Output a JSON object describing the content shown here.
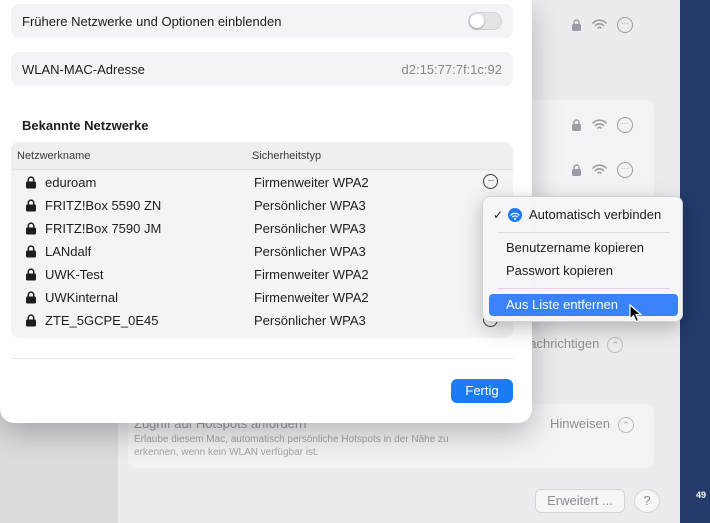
{
  "background": {
    "notifications_label": "nachrichtigen",
    "hotspot_title": "Zugriff auf Hotspots anfordern",
    "hotspot_desc_1": "Erlaube diesem Mac, automatisch persönliche Hotspots in der Nähe zu",
    "hotspot_desc_2": "erkennen, wenn kein WLAN verfügbar ist.",
    "hotspot_value": "Hinweisen",
    "advanced_button": "Erweitert ...",
    "help_button": "?",
    "dock_number": "49"
  },
  "sheet": {
    "show_legacy_label": "Frühere Netzwerke und Optionen einblenden",
    "mac_label": "WLAN-MAC-Adresse",
    "mac_value": "d2:15:77:7f:1c:92",
    "known_title": "Bekannte Netzwerke",
    "col_name": "Netzwerkname",
    "col_security": "Sicherheitstyp",
    "networks": [
      {
        "name": "eduroam",
        "security": "Firmenweiter WPA2"
      },
      {
        "name": "FRITZ!Box 5590 ZN",
        "security": "Persönlicher WPA3"
      },
      {
        "name": "FRITZ!Box 7590 JM",
        "security": "Persönlicher WPA3"
      },
      {
        "name": "LANdalf",
        "security": "Persönlicher WPA3"
      },
      {
        "name": "UWK-Test",
        "security": "Firmenweiter WPA2"
      },
      {
        "name": "UWKinternal",
        "security": "Firmenweiter WPA2"
      },
      {
        "name": "ZTE_5GCPE_0E45",
        "security": "Persönlicher WPA3"
      }
    ],
    "more_glyph": "···",
    "done_button": "Fertig"
  },
  "menu": {
    "check_glyph": "✓",
    "auto_connect": "Automatisch verbinden",
    "copy_username": "Benutzername kopieren",
    "copy_password": "Passwort kopieren",
    "remove_from_list": "Aus Liste entfernen"
  },
  "colors": {
    "accent": "#1a7cf5",
    "highlight": "#3a82f7",
    "desktop": "#233a6a"
  }
}
